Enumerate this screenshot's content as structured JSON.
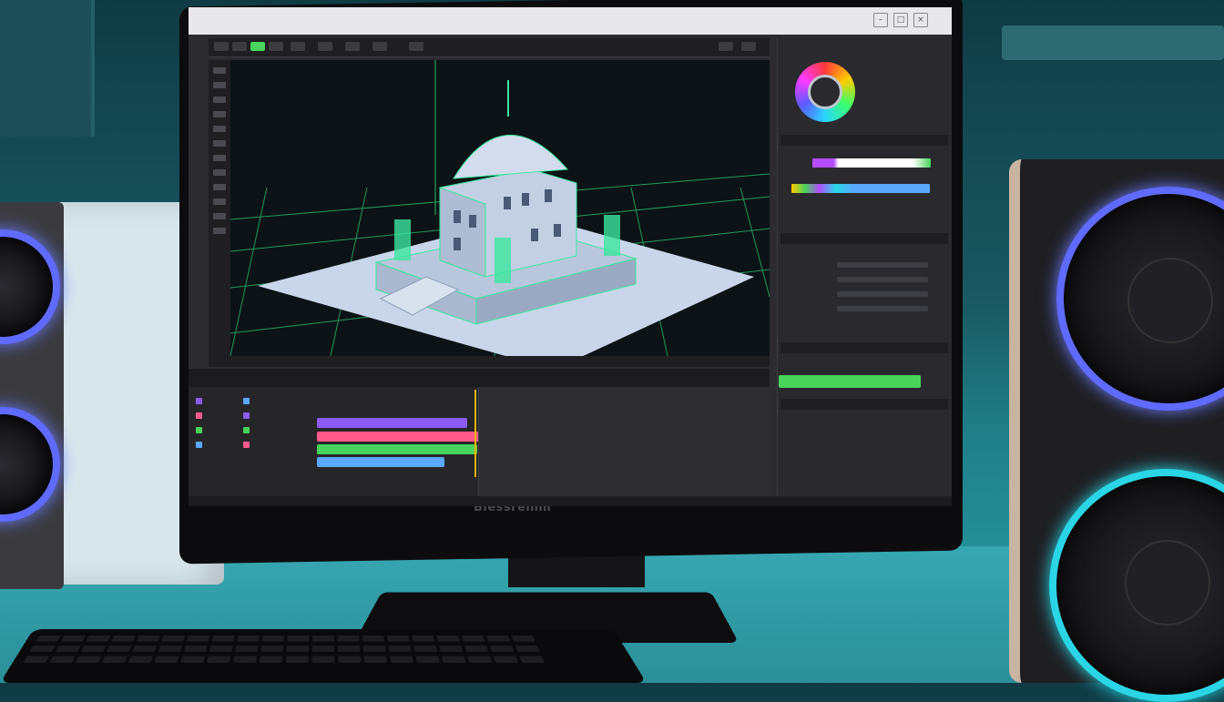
{
  "scene": {
    "monitor_brand": "Blessremm",
    "app_title": ""
  },
  "timeline": {
    "tabs": [
      "",
      ""
    ],
    "tracks": [
      {
        "color": "#8b5cf6"
      },
      {
        "color": "#ff5a8a"
      },
      {
        "color": "#48d45a"
      },
      {
        "color": "#5aa8ff"
      }
    ]
  },
  "colors": {
    "wall": "#1a5a63",
    "desk": "#2b8f98",
    "viewport_bg": "#0c1316",
    "grid": "#39ff88",
    "model": "#c9d6ea",
    "model_accent": "#3ce6a0",
    "accent_green": "#48d45a",
    "speaker_ring_blue": "#5f6bff",
    "speaker_ring_cyan": "#2ad6e6"
  },
  "icons": [
    "minimize-icon",
    "maximize-icon",
    "close-icon",
    "color-wheel-icon"
  ]
}
